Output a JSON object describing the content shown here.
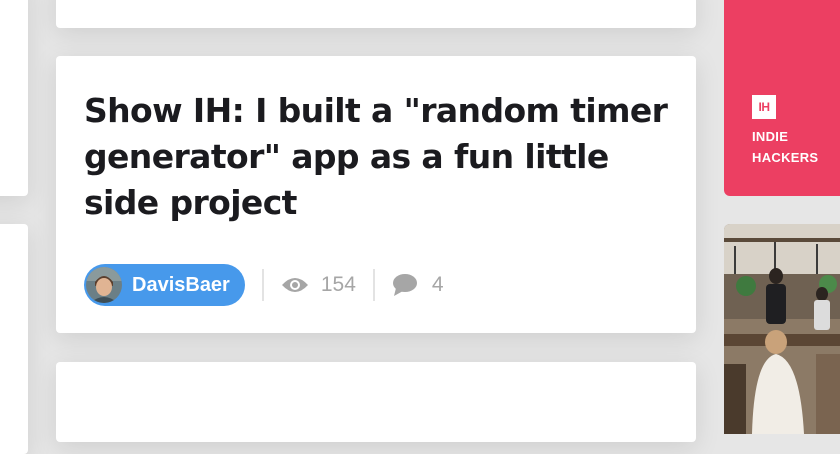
{
  "post": {
    "title": "Show IH: I built a \"random timer generator\" app as a fun little side project",
    "author": "DavisBaer",
    "views": "154",
    "comments": "4"
  },
  "sidebar_ad": {
    "logo_text": "IH",
    "line1": "INDIE",
    "line2": "HACKERS",
    "bg_color": "#ec3f62"
  },
  "colors": {
    "author_pill": "#4799eb",
    "meta_gray": "#a6a6a6"
  },
  "icons": {
    "views": "eye-icon",
    "comments": "speech-bubble-icon"
  }
}
